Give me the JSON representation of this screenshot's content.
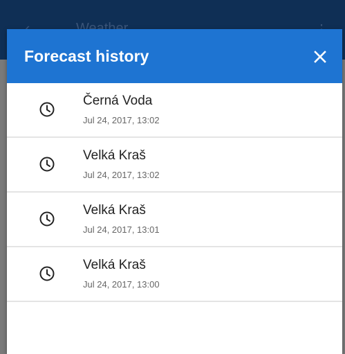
{
  "background": {
    "title": "Weather"
  },
  "dialog": {
    "title": "Forecast history",
    "close_icon": "close-icon",
    "items": [
      {
        "name": "Černá Voda",
        "time": "Jul 24, 2017, 13:02",
        "icon": "clock-icon"
      },
      {
        "name": "Velká Kraš",
        "time": "Jul 24, 2017, 13:02",
        "icon": "clock-icon"
      },
      {
        "name": "Velká Kraš",
        "time": "Jul 24, 2017, 13:01",
        "icon": "clock-icon"
      },
      {
        "name": "Velká Kraš",
        "time": "Jul 24, 2017, 13:00",
        "icon": "clock-icon"
      }
    ]
  },
  "colors": {
    "header": "#1e74d2",
    "background_appbar": "#0f2f55"
  }
}
